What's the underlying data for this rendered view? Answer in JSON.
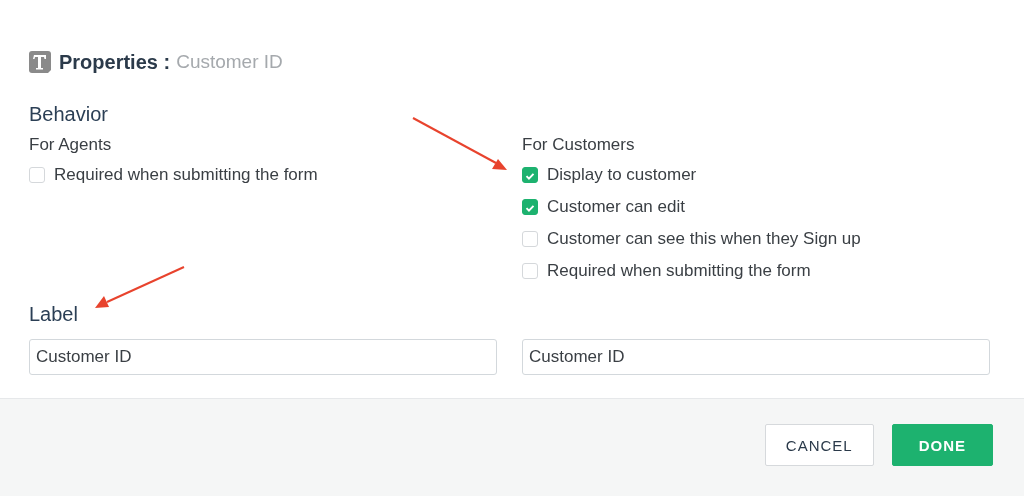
{
  "header": {
    "title": "Properties :",
    "subtitle": "Customer ID"
  },
  "behavior": {
    "heading": "Behavior",
    "agents": {
      "heading": "For Agents",
      "options": [
        {
          "label": "Required when submitting the form",
          "checked": false
        }
      ]
    },
    "customers": {
      "heading": "For Customers",
      "options": [
        {
          "label": "Display to customer",
          "checked": true
        },
        {
          "label": "Customer can edit",
          "checked": true
        },
        {
          "label": "Customer can see this when they Sign up",
          "checked": false
        },
        {
          "label": "Required when submitting the form",
          "checked": false
        }
      ]
    }
  },
  "label": {
    "heading": "Label",
    "fields": [
      {
        "value": "Customer ID"
      },
      {
        "value": "Customer ID"
      }
    ]
  },
  "buttons": [
    {
      "label": "CANCEL",
      "kind": "secondary"
    },
    {
      "label": "DONE",
      "kind": "primary"
    }
  ]
}
